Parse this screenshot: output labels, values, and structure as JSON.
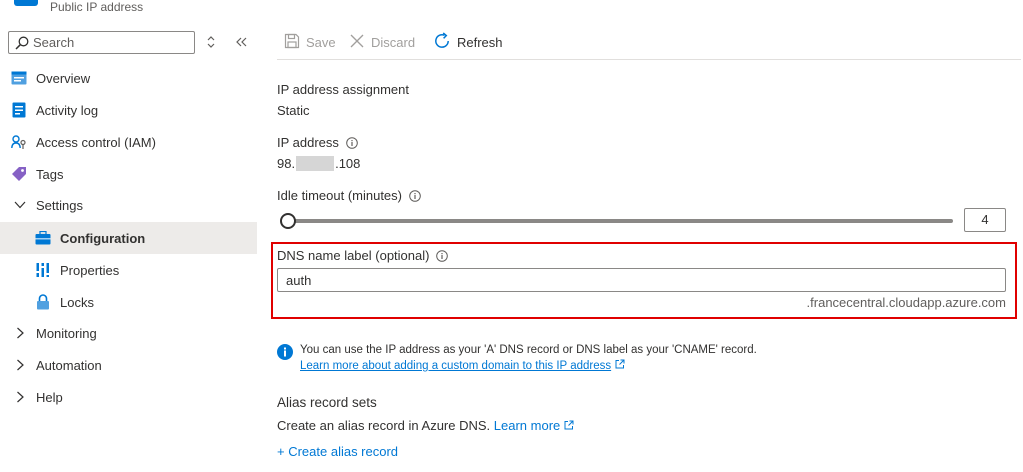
{
  "header": {
    "subtitle": "Public IP address"
  },
  "sidebar": {
    "search_placeholder": "Search",
    "items": [
      {
        "label": "Overview",
        "icon": "overview-icon"
      },
      {
        "label": "Activity log",
        "icon": "activity-log-icon"
      },
      {
        "label": "Access control (IAM)",
        "icon": "access-control-icon"
      },
      {
        "label": "Tags",
        "icon": "tag-icon"
      },
      {
        "label": "Settings",
        "icon": "chevron-down-icon"
      },
      {
        "label": "Configuration",
        "icon": "configuration-icon",
        "selected": true
      },
      {
        "label": "Properties",
        "icon": "properties-icon"
      },
      {
        "label": "Locks",
        "icon": "lock-icon"
      },
      {
        "label": "Monitoring",
        "icon": "chevron-right-icon"
      },
      {
        "label": "Automation",
        "icon": "chevron-right-icon"
      },
      {
        "label": "Help",
        "icon": "chevron-right-icon"
      }
    ]
  },
  "toolbar": {
    "save_label": "Save",
    "discard_label": "Discard",
    "refresh_label": "Refresh"
  },
  "form": {
    "assignment_label": "IP address assignment",
    "assignment_value": "Static",
    "ip_label": "IP address",
    "ip_prefix": "98.",
    "ip_suffix": ".108",
    "idle_label": "Idle timeout (minutes)",
    "idle_value": "4",
    "idle_fraction": 0,
    "dns_label": "DNS name label (optional)",
    "dns_value": "auth",
    "dns_suffix": ".francecentral.cloudapp.azure.com"
  },
  "info": {
    "text": "You can use the IP address as your 'A' DNS record or DNS label as your 'CNAME' record.",
    "link": "Learn more about adding a custom domain to this IP address"
  },
  "alias": {
    "title": "Alias record sets",
    "desc": "Create an alias record in Azure DNS.",
    "learn_more": "Learn more",
    "create": "+ Create alias record"
  },
  "colors": {
    "accent": "#0078d4",
    "highlight": "#e00000",
    "selected_bg": "#edebe9"
  }
}
